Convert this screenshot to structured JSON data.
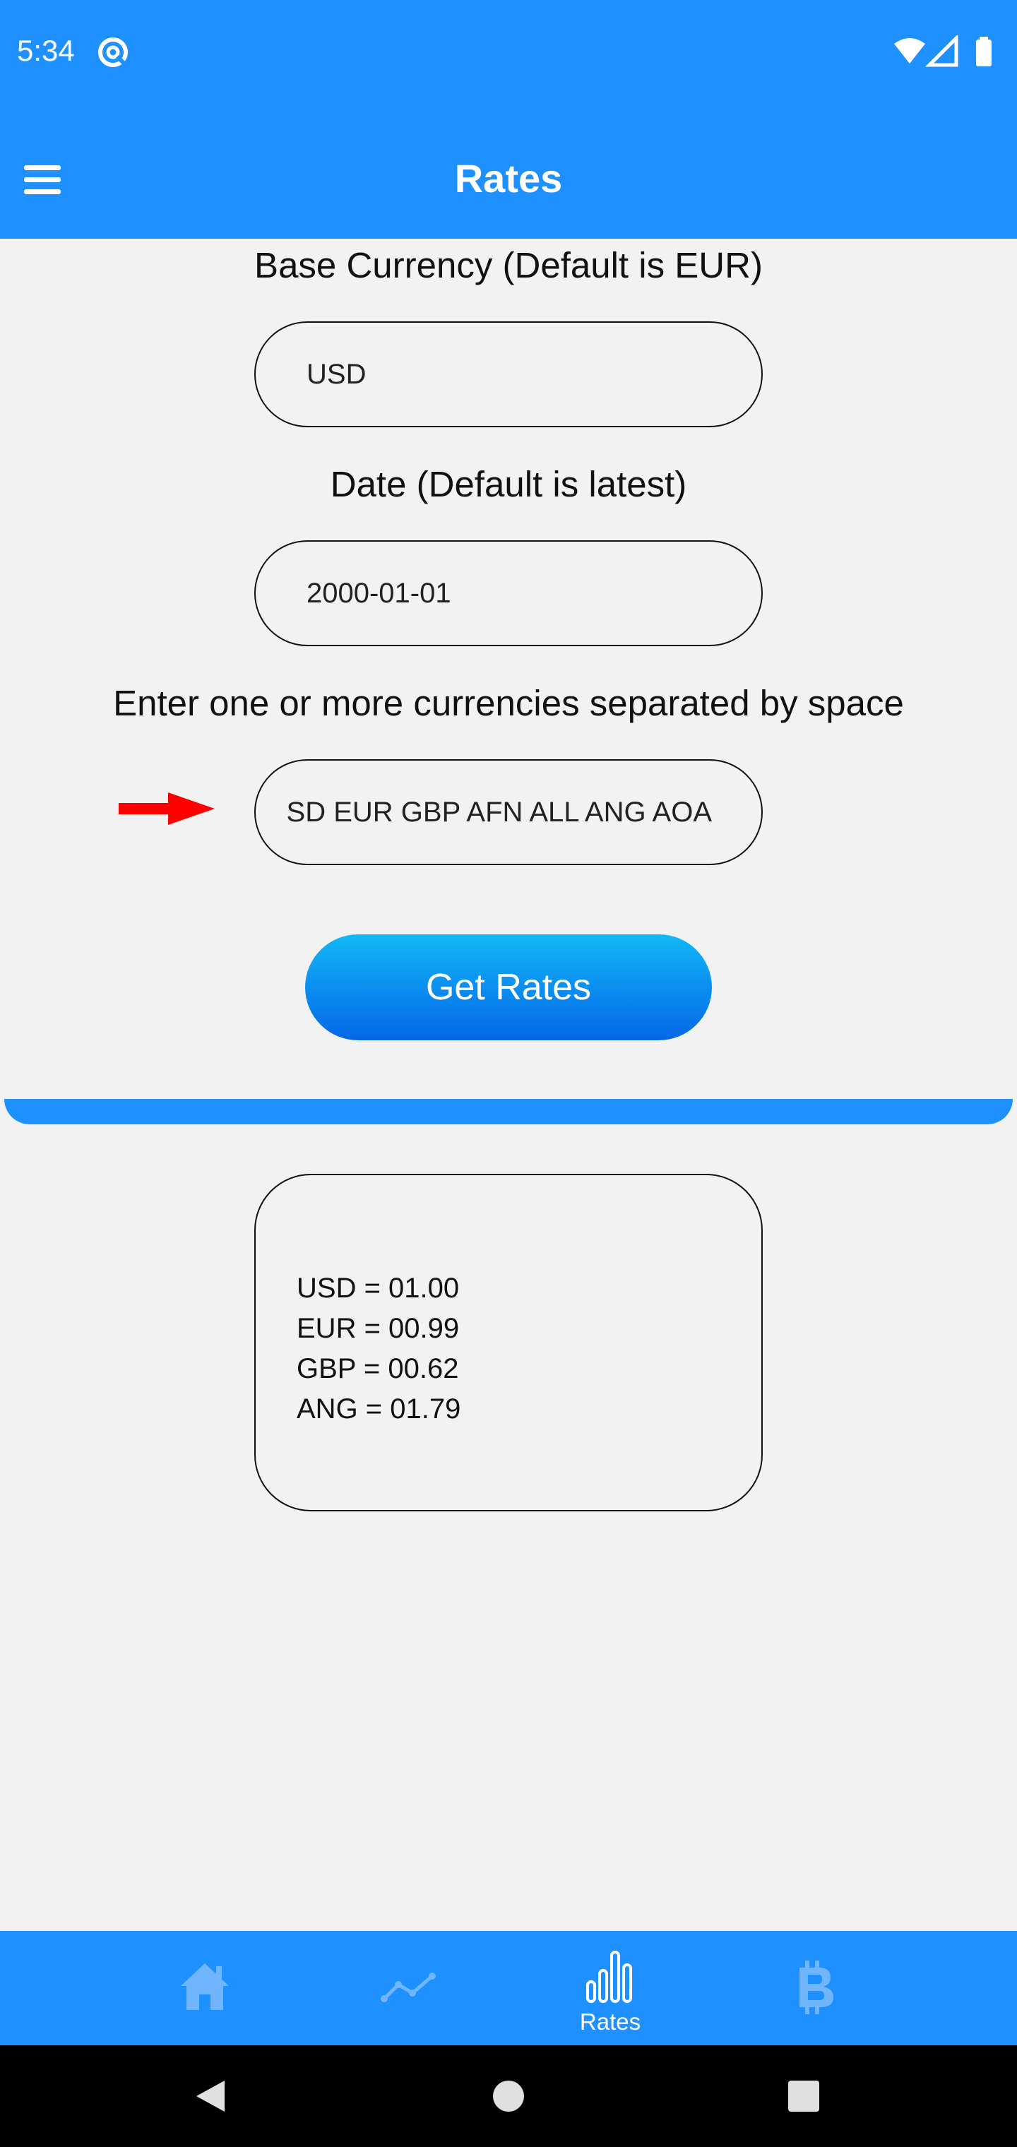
{
  "status_bar": {
    "time": "5:34"
  },
  "app_bar": {
    "title": "Rates"
  },
  "form": {
    "base_label": "Base Currency (Default is EUR)",
    "base_value": "USD",
    "date_label": "Date (Default is latest)",
    "date_value": "2000-01-01",
    "currencies_label": "Enter one or more currencies separated by space",
    "currencies_value": "SD EUR GBP AFN ALL ANG AOA",
    "submit_label": "Get Rates"
  },
  "results": {
    "lines": [
      "USD = 01.00",
      "EUR = 00.99",
      "GBP = 00.62",
      "ANG = 01.79"
    ]
  },
  "bottom_nav": {
    "items": [
      {
        "icon": "home-icon",
        "label": ""
      },
      {
        "icon": "trend-line-icon",
        "label": ""
      },
      {
        "icon": "bar-chart-icon",
        "label": "Rates"
      },
      {
        "icon": "bitcoin-icon",
        "label": ""
      }
    ]
  },
  "colors": {
    "primary": "#1e90ff",
    "inactive_icon": "#6fb6ff",
    "background": "#f2f2f2",
    "arrow": "#ff0000"
  }
}
